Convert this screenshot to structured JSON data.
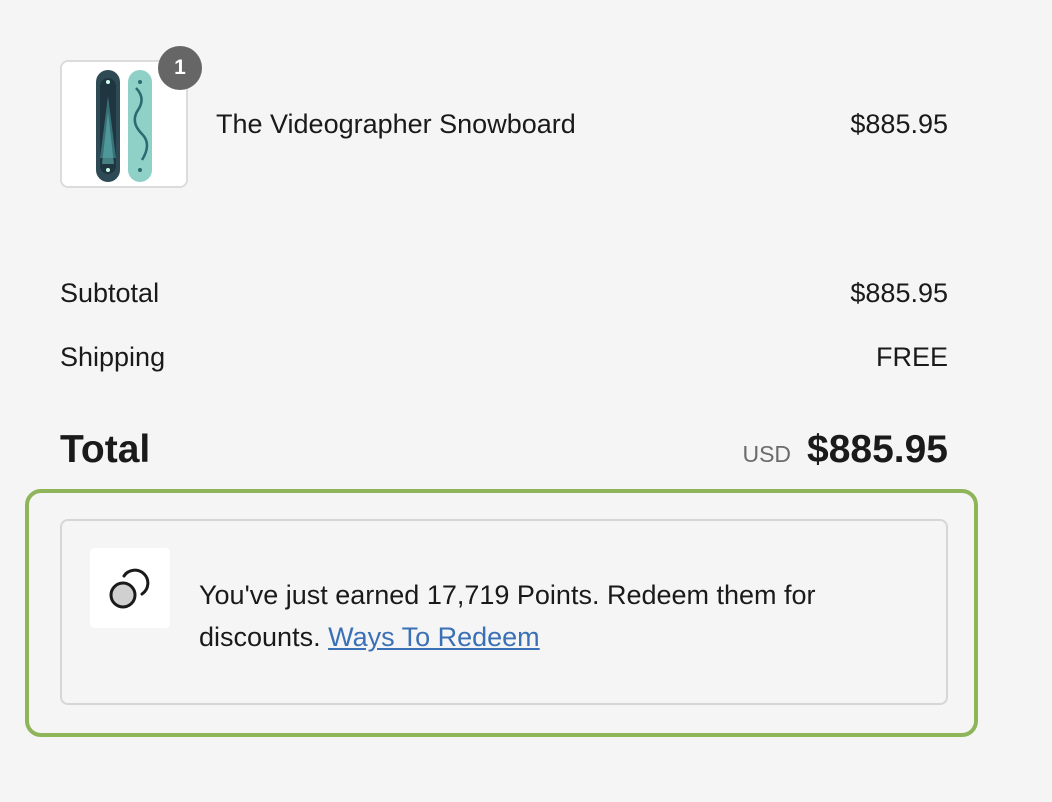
{
  "line_item": {
    "quantity": "1",
    "name": "The Videographer Snowboard",
    "price": "$885.95",
    "image_icon": "snowboard-image"
  },
  "summary": {
    "subtotal_label": "Subtotal",
    "subtotal_value": "$885.95",
    "shipping_label": "Shipping",
    "shipping_value": "FREE",
    "total_label": "Total",
    "total_currency": "USD",
    "total_value": "$885.95"
  },
  "rewards": {
    "icon": "coins-icon",
    "message": "You've just earned 17,719 Points. Redeem them for discounts.",
    "link_label": "Ways To Redeem"
  },
  "colors": {
    "background": "#f5f5f5",
    "rewards_border": "#8fb55a",
    "link": "#3a70b5",
    "badge": "#666666"
  }
}
